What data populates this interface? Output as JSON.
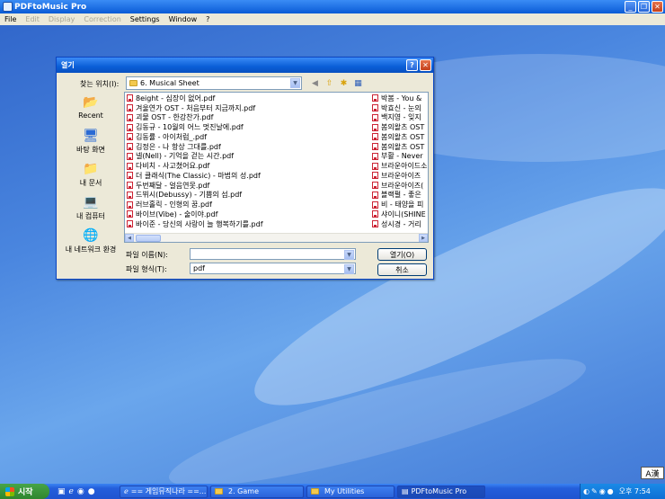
{
  "app": {
    "title": "PDFtoMusic Pro",
    "menu": [
      {
        "label": "File",
        "enabled": true
      },
      {
        "label": "Edit",
        "enabled": false
      },
      {
        "label": "Display",
        "enabled": false
      },
      {
        "label": "Correction",
        "enabled": false
      },
      {
        "label": "Settings",
        "enabled": true
      },
      {
        "label": "Window",
        "enabled": true
      },
      {
        "label": "?",
        "enabled": true
      }
    ]
  },
  "dialog": {
    "title": "열기",
    "look_in_label": "찾는 위치(I):",
    "look_in_value": "6. Musical Sheet",
    "places": [
      {
        "label": "Recent",
        "icon": "recent-icon"
      },
      {
        "label": "바탕 화면",
        "icon": "desktop-icon"
      },
      {
        "label": "내 문서",
        "icon": "my-documents-icon"
      },
      {
        "label": "내 컴퓨터",
        "icon": "my-computer-icon"
      },
      {
        "label": "내 네트워크 환경",
        "icon": "network-icon"
      }
    ],
    "files_col1": [
      "8eight - 심장이 없어.pdf",
      "겨울연가 OST - 처음부터 지금까지.pdf",
      "괴물 OST - 한강찬가.pdf",
      "김동규 - 10월의 어느 멋진날에.pdf",
      "김동률 - 아이처럼_.pdf",
      "김정은 - 나 항상 그대를.pdf",
      "넬(Nell) - 기억을 걷는 시간.pdf",
      "다비치 - 사고쳤어요.pdf",
      "더 클래식(The Classic) - 마법의 성.pdf",
      "두번째달 - 얼음연못.pdf",
      "드뷔시(Debussy) - 기쁨의 섬.pdf",
      "러브홀릭 - 인형의 꿈.pdf",
      "바이브(Vibe) - 술이야.pdf",
      "바이준 - 당신의 사랑이 늘 행복하기를.pdf"
    ],
    "files_col2": [
      "박봄 - You &",
      "박효신 - 눈의",
      "백지영 - 잊지",
      "봄의왈츠 OST",
      "봄의왈츠 OST",
      "봄의왈츠 OST",
      "부활 - Never",
      "브라운아이드소",
      "브라운아이즈",
      "브라운아이즈(",
      "블랙펄 - 좋은",
      "비 - 태양을 피",
      "샤이니(SHINE",
      "성시경 - 거리"
    ],
    "filename_label": "파일 이름(N):",
    "filename_value": "",
    "filetype_label": "파일 형식(T):",
    "filetype_value": "pdf",
    "open_button": "열기(O)",
    "cancel_button": "취소"
  },
  "taskbar": {
    "start_label": "시작",
    "tasks": [
      {
        "label": "== 게임뮤직나라 ==..."
      },
      {
        "label": "2. Game"
      },
      {
        "label": "My Utilities"
      },
      {
        "label": "PDFtoMusic Pro"
      }
    ],
    "clock": "오후 7:54"
  },
  "ime_indicator": "A漢"
}
